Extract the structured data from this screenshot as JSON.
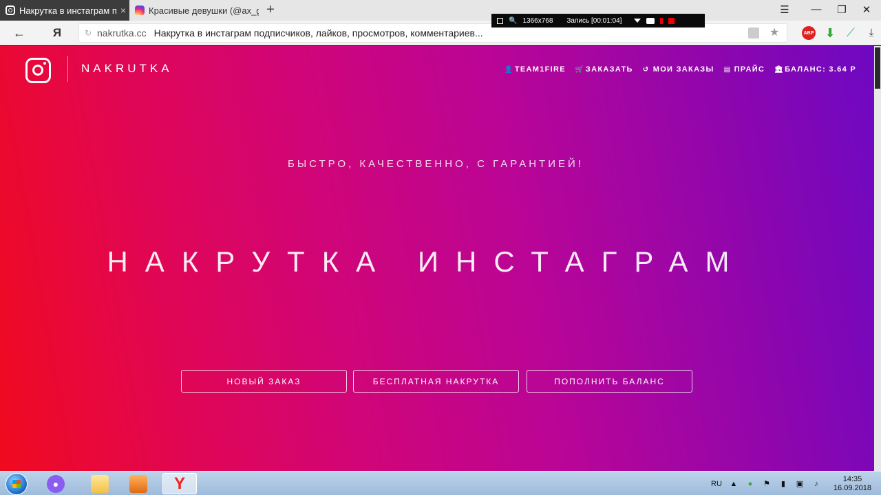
{
  "browser": {
    "tabs": [
      {
        "title": "Накрутка в инстаграм по",
        "close": "×",
        "active": true
      },
      {
        "title": "Красивые девушки (@ax_g",
        "active": false
      }
    ],
    "new_tab": "+",
    "window_controls": {
      "menu": "☰",
      "minimize": "—",
      "restore": "❐",
      "close": "✕"
    },
    "address": {
      "domain": "nakrutka.cc",
      "page_title": "Накрутка в инстаграм подписчиков, лайков, просмотров, комментариев..."
    },
    "back": "←",
    "yandex_button": "Я",
    "extensions": {
      "abp": "ABP"
    }
  },
  "recorder": {
    "resolution": "1366x768",
    "status": "Запись [00:01:04]"
  },
  "site": {
    "logo_text": "NAKRUTKA",
    "nav": [
      {
        "label": "TEAM1FIRE",
        "icon": "user-icon",
        "glyph": "👤"
      },
      {
        "label": "ЗАКАЗАТЬ",
        "icon": "cart-icon",
        "glyph": "🛒"
      },
      {
        "label": "МОИ ЗАКАЗЫ",
        "icon": "history-icon",
        "glyph": "↺"
      },
      {
        "label": "ПРАЙС",
        "icon": "list-icon",
        "glyph": "▤"
      },
      {
        "label": "БАЛАНС: 3.64 Р",
        "icon": "bank-icon",
        "glyph": "🏛"
      }
    ],
    "subtitle": "БЫСТРО, КАЧЕСТВЕННО, С ГАРАНТИЕЙ!",
    "title": "НАКРУТКА ИНСТАГРАМ",
    "buttons": {
      "new_order": "НОВЫЙ ЗАКАЗ",
      "free_boost": "БЕСПЛАТНАЯ НАКРУТКА",
      "top_up": "ПОПОЛНИТЬ БАЛАНС"
    },
    "colors": {
      "gradient_start": "#f00a1e",
      "gradient_mid": "#d10577",
      "gradient_end": "#6e08c2"
    }
  },
  "taskbar": {
    "language": "RU",
    "time": "14:35",
    "date": "16.09.2018"
  }
}
